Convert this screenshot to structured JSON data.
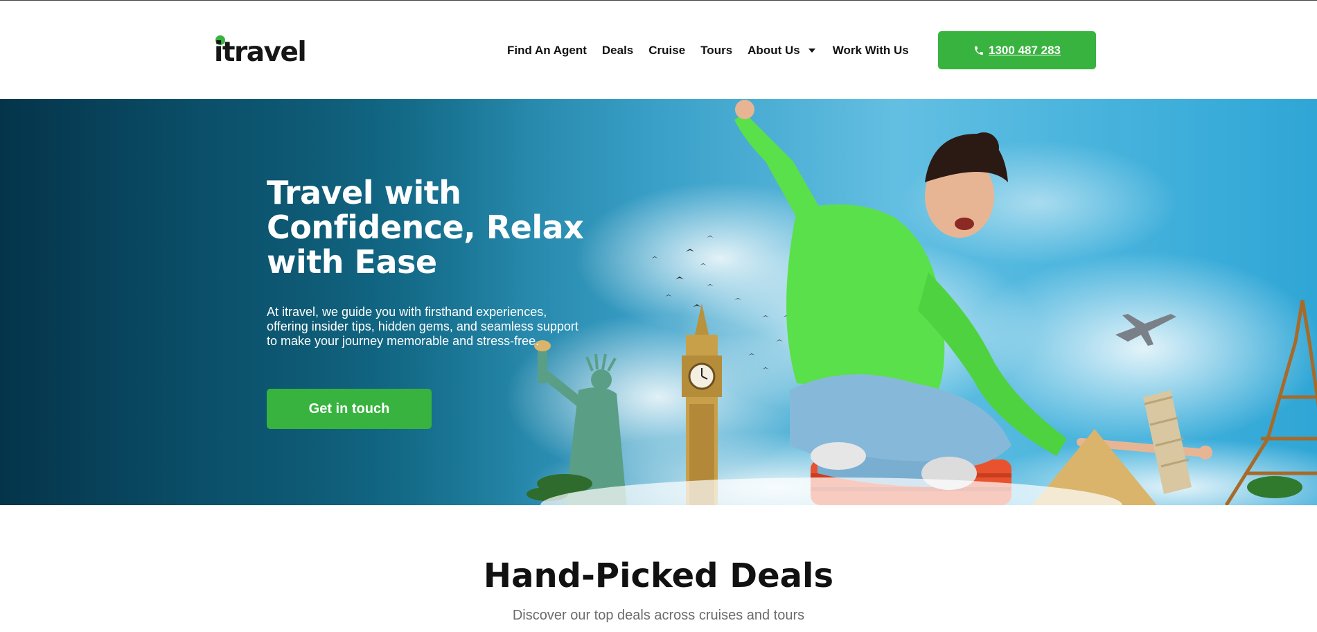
{
  "brand": {
    "name": "itravel",
    "accent_color": "#38b33f"
  },
  "nav": {
    "items": [
      {
        "label": "Find An Agent"
      },
      {
        "label": "Deals"
      },
      {
        "label": "Cruise"
      },
      {
        "label": "Tours"
      },
      {
        "label": "About Us",
        "has_dropdown": true
      },
      {
        "label": "Work With Us"
      }
    ],
    "phone": {
      "label": "1300 487 283",
      "icon": "phone-icon"
    }
  },
  "hero": {
    "title": "Travel with Confidence, Relax with Ease",
    "description": "At itravel, we guide you with firsthand experiences, offering insider tips, hidden gems, and seamless support to make your journey memorable and stress-free.",
    "cta_label": "Get in touch"
  },
  "deals": {
    "title": "Hand-Picked Deals",
    "subtitle": "Discover our top deals across cruises and tours"
  }
}
